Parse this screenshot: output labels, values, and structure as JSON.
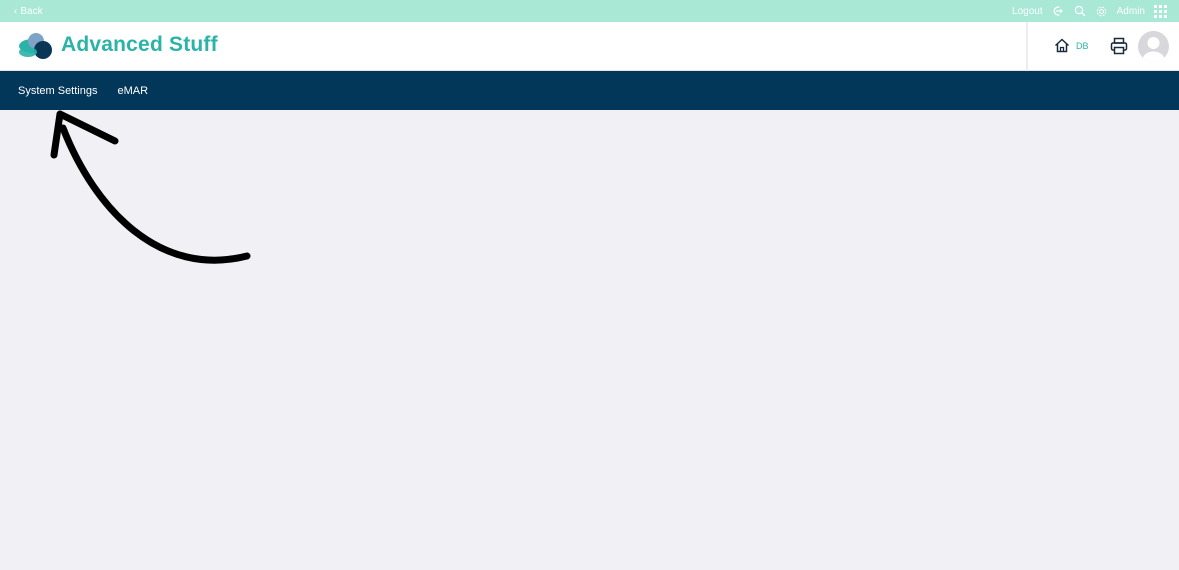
{
  "topbar": {
    "back_label": "Back",
    "logout_label": "Logout",
    "user_label": "Admin"
  },
  "header": {
    "brand": "Advanced Stuff",
    "home_badge": "DB"
  },
  "nav": {
    "items": [
      {
        "label": "System Settings"
      },
      {
        "label": "eMAR"
      }
    ]
  },
  "colors": {
    "topbar": "#a8e8d4",
    "brand": "#2bb3a8",
    "navbar": "#03375a",
    "content_bg": "#f0f0f5"
  },
  "icons": [
    "chevron-left-icon",
    "logout-icon",
    "search-icon",
    "gear-icon",
    "apps-grid-icon",
    "home-icon",
    "printer-icon",
    "avatar-icon"
  ]
}
